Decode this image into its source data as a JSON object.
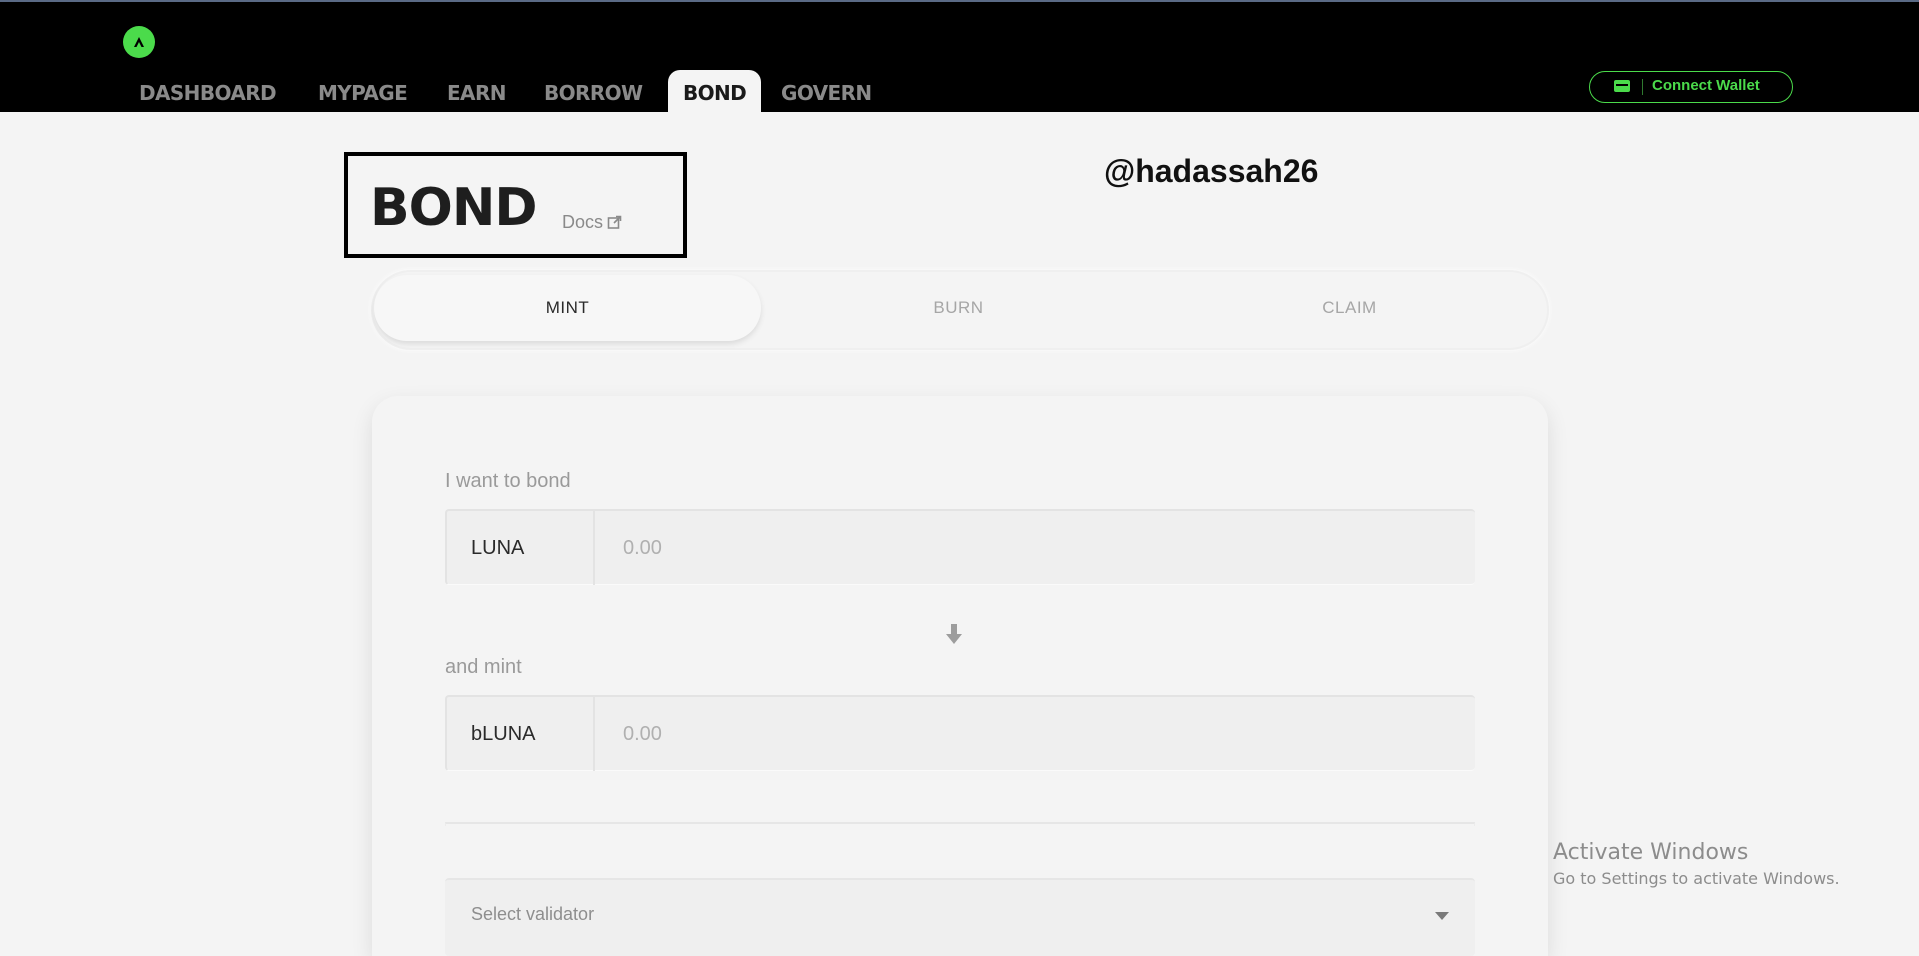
{
  "nav": {
    "tabs": [
      {
        "label": "DASHBOARD",
        "active": false
      },
      {
        "label": "MYPAGE",
        "active": false
      },
      {
        "label": "EARN",
        "active": false
      },
      {
        "label": "BORROW",
        "active": false
      },
      {
        "label": "BOND",
        "active": true
      },
      {
        "label": "GOVERN",
        "active": false
      }
    ],
    "connect_wallet_label": "Connect Wallet"
  },
  "page": {
    "title": "BOND",
    "docs_label": "Docs",
    "watermark": "@hadassah26"
  },
  "subtabs": [
    {
      "label": "MINT",
      "active": true
    },
    {
      "label": "BURN",
      "active": false
    },
    {
      "label": "CLAIM",
      "active": false
    }
  ],
  "form": {
    "bond_label": "I want to bond",
    "bond_asset": "LUNA",
    "bond_placeholder": "0.00",
    "mint_label": "and mint",
    "mint_asset": "bLUNA",
    "mint_placeholder": "0.00",
    "validator_placeholder": "Select validator"
  },
  "os_notice": {
    "title": "Activate Windows",
    "subtitle": "Go to Settings to activate Windows."
  },
  "colors": {
    "accent": "#4bdb4b",
    "header_bg": "#000000",
    "page_bg": "#f4f4f4"
  }
}
